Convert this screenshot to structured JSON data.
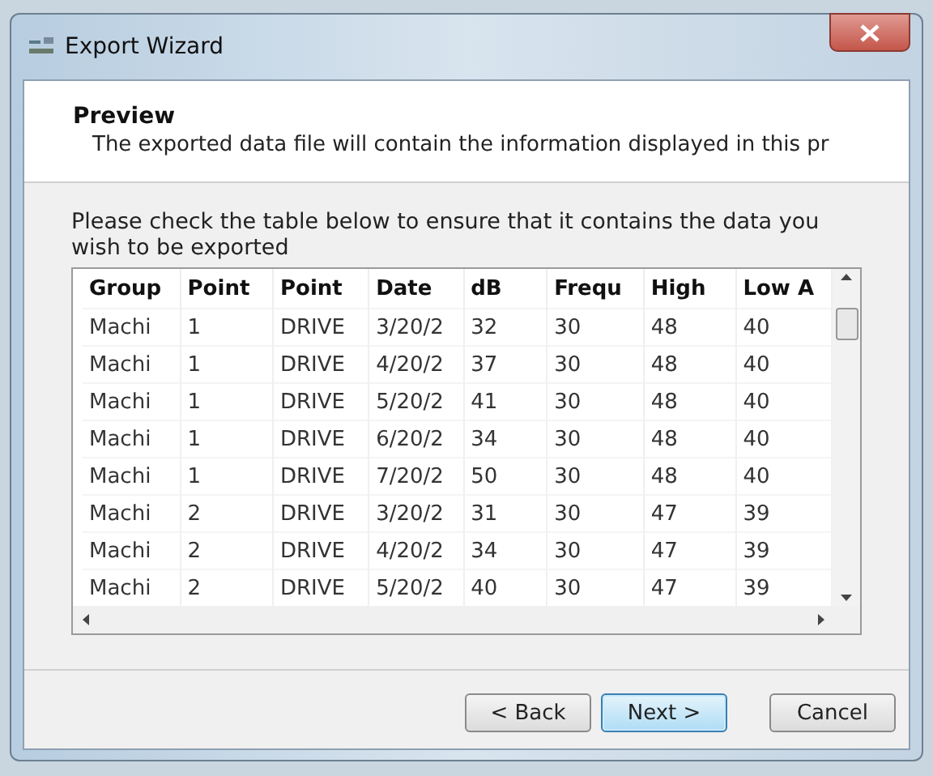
{
  "window": {
    "title": "Export Wizard"
  },
  "header": {
    "title": "Preview",
    "description": "The exported data file will contain the information displayed in this pr"
  },
  "instructions": "Please check the table below to ensure that it contains the data you wish to be exported",
  "table": {
    "columns": [
      "Group",
      "Point",
      "Point",
      "Date",
      "dB",
      "Frequ",
      "High",
      "Low A"
    ],
    "rows": [
      [
        "Machi",
        "1",
        "DRIVE",
        "3/20/2",
        "32",
        "30",
        "48",
        "40"
      ],
      [
        "Machi",
        "1",
        "DRIVE",
        "4/20/2",
        "37",
        "30",
        "48",
        "40"
      ],
      [
        "Machi",
        "1",
        "DRIVE",
        "5/20/2",
        "41",
        "30",
        "48",
        "40"
      ],
      [
        "Machi",
        "1",
        "DRIVE",
        "6/20/2",
        "34",
        "30",
        "48",
        "40"
      ],
      [
        "Machi",
        "1",
        "DRIVE",
        "7/20/2",
        "50",
        "30",
        "48",
        "40"
      ],
      [
        "Machi",
        "2",
        "DRIVE",
        "3/20/2",
        "31",
        "30",
        "47",
        "39"
      ],
      [
        "Machi",
        "2",
        "DRIVE",
        "4/20/2",
        "34",
        "30",
        "47",
        "39"
      ],
      [
        "Machi",
        "2",
        "DRIVE",
        "5/20/2",
        "40",
        "30",
        "47",
        "39"
      ]
    ]
  },
  "buttons": [
    {
      "label": "< Back",
      "default": false
    },
    {
      "label": "Next >",
      "default": true
    },
    {
      "label": "Cancel",
      "default": false
    }
  ]
}
